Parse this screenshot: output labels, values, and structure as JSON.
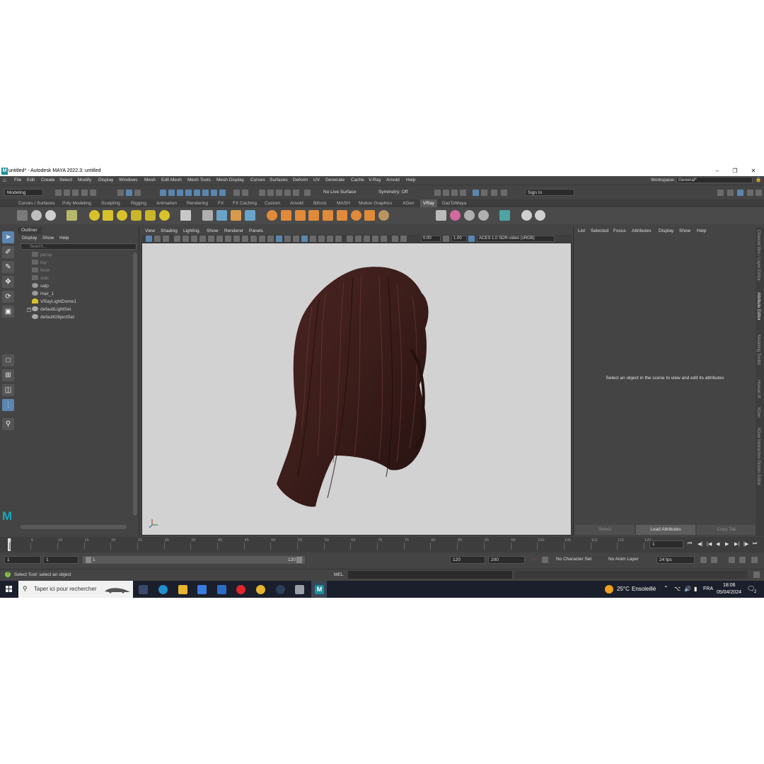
{
  "titlebar": {
    "title": "untitled* - Autodesk MAYA 2022.3: untitled",
    "logo": "M",
    "minimize_icon": "minimize-icon",
    "restore_icon": "restore-icon",
    "close_icon": "close-icon"
  },
  "menubar": {
    "items": [
      "File",
      "Edit",
      "Create",
      "Select",
      "Modify",
      "Display",
      "Windows",
      "Mesh",
      "Edit Mesh",
      "Mesh Tools",
      "Mesh Display",
      "Curves",
      "Surfaces",
      "Deform",
      "UV",
      "Generate",
      "Cache",
      "V-Ray",
      "Arnold",
      "Help"
    ],
    "workspace_label": "Workspace:",
    "workspace_value": "General*"
  },
  "statusline": {
    "menuset": "Modeling",
    "live_surface": "No Live Surface",
    "symmetry": "Symmetry: Off",
    "sign_in": "Sign In"
  },
  "shelf": {
    "tabs": [
      "Curves / Surfaces",
      "Poly Modeling",
      "Sculpting",
      "Rigging",
      "Animation",
      "Rendering",
      "FX",
      "FX Caching",
      "Custom",
      "Arnold",
      "Bifrost",
      "MASH",
      "Motion Graphics",
      "XGen",
      "VRay",
      "DazToMaya"
    ],
    "active_tab": "VRay"
  },
  "outliner": {
    "title": "Outliner",
    "menu": [
      "Display",
      "Show",
      "Help"
    ],
    "search_placeholder": "Search...",
    "items": [
      {
        "label": "persp",
        "icon": "camera-icon",
        "dim": true
      },
      {
        "label": "top",
        "icon": "camera-icon",
        "dim": true
      },
      {
        "label": "front",
        "icon": "camera-icon",
        "dim": true
      },
      {
        "label": "side",
        "icon": "camera-icon",
        "dim": true
      },
      {
        "label": "salp",
        "icon": "transform-icon",
        "dim": false
      },
      {
        "label": "Hair_1",
        "icon": "transform-icon",
        "dim": false
      },
      {
        "label": "VRayLightDome1",
        "icon": "light-dome-icon",
        "dim": false
      },
      {
        "label": "defaultLightSet",
        "icon": "set-icon",
        "dim": false
      },
      {
        "label": "defaultObjectSet",
        "icon": "set-icon",
        "dim": false
      }
    ]
  },
  "viewport": {
    "menu": [
      "View",
      "Shading",
      "Lighting",
      "Show",
      "Renderer",
      "Panels"
    ],
    "exposure": "0.00",
    "gamma": "1.00",
    "color_space": "ACES 1.0 SDR-video (sRGB)"
  },
  "attribute_editor": {
    "menu": [
      "List",
      "Selected",
      "Focus",
      "Attributes",
      "Display",
      "Show",
      "Help"
    ],
    "message": "Select an object in the scene to view and edit its attributes",
    "buttons": [
      "Select",
      "Load Attributes",
      "Copy Tab"
    ],
    "side_tabs": [
      "Channel Box / Layer Editor",
      "Attribute Editor",
      "Modeling Toolkit",
      "Human IK",
      "XGen",
      "XGen Interactive Groom Editor"
    ]
  },
  "timeslider": {
    "ticks": [
      "1",
      "5",
      "10",
      "15",
      "20",
      "25",
      "30",
      "35",
      "40",
      "45",
      "50",
      "55",
      "60",
      "65",
      "70",
      "75",
      "80",
      "85",
      "90",
      "95",
      "100",
      "105",
      "110",
      "115",
      "120"
    ],
    "current_frame": "1"
  },
  "range": {
    "start": "1",
    "anim_start": "1",
    "range_start": "1",
    "range_end": "120",
    "anim_end": "120",
    "end": "200",
    "character_set": "No Character Set",
    "anim_layer": "No Anim Layer",
    "fps": "24 fps"
  },
  "helpline": {
    "text": "Select Tool: select an object",
    "cmd_lang": "MEL"
  },
  "taskbar": {
    "search_placeholder": "Taper ici pour rechercher",
    "weather_temp": "25°C",
    "weather_desc": "Ensoleillé",
    "language": "FRA",
    "time": "18:06",
    "date": "05/04/2024",
    "notifications": "2"
  },
  "colors": {
    "maya_bg": "#444444",
    "viewport_bg": "#d2d2d2",
    "accent_blue": "#5a86b0",
    "hair_color": "#3b1d1a"
  }
}
